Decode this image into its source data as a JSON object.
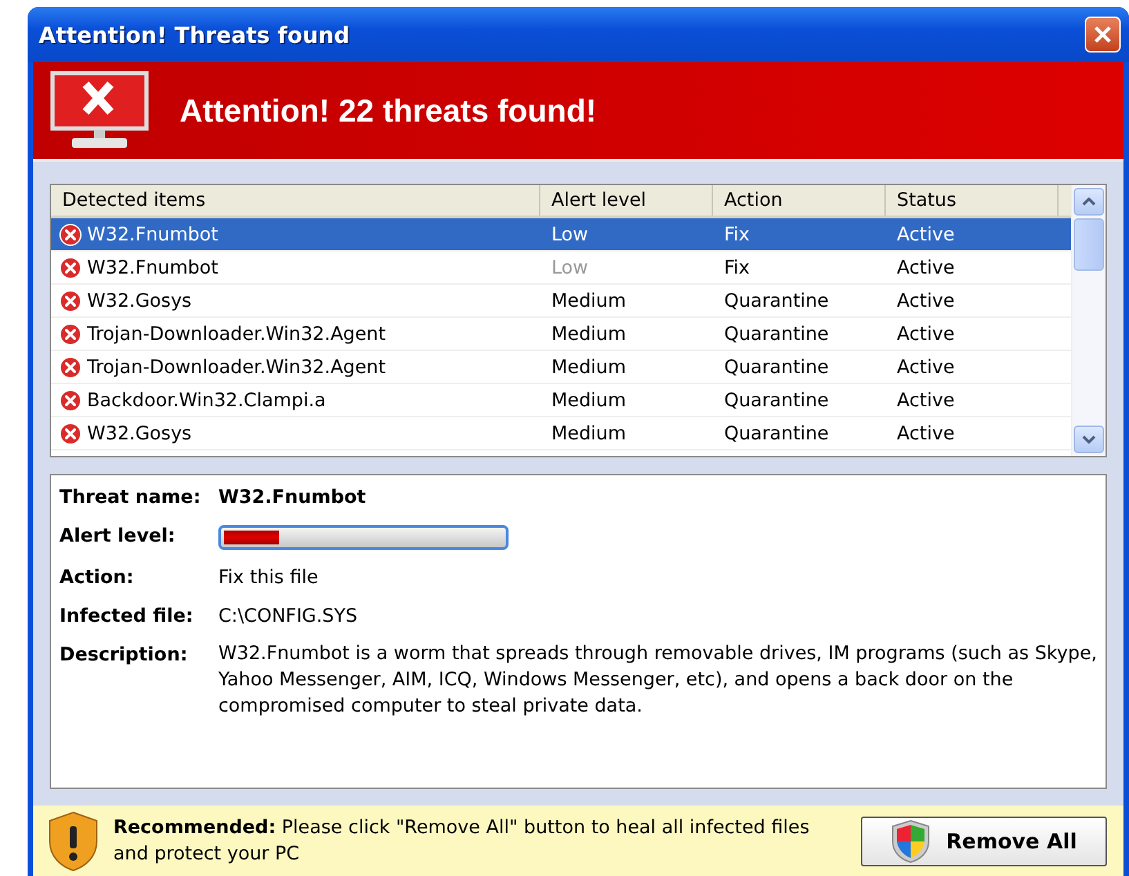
{
  "window": {
    "title": "Attention! Threats found"
  },
  "banner": {
    "text": "Attention! 22 threats found!"
  },
  "table": {
    "columns": [
      "Detected items",
      "Alert level",
      "Action",
      "Status"
    ],
    "rows": [
      {
        "name": "W32.Fnumbot",
        "alert": "Low",
        "alert_dimmed": false,
        "action": "Fix",
        "status": "Active",
        "selected": true
      },
      {
        "name": "W32.Fnumbot",
        "alert": "Low",
        "alert_dimmed": true,
        "action": "Fix",
        "status": "Active",
        "selected": false
      },
      {
        "name": "W32.Gosys",
        "alert": "Medium",
        "alert_dimmed": false,
        "action": "Quarantine",
        "status": "Active",
        "selected": false
      },
      {
        "name": "Trojan-Downloader.Win32.Agent",
        "alert": "Medium",
        "alert_dimmed": false,
        "action": "Quarantine",
        "status": "Active",
        "selected": false
      },
      {
        "name": "Trojan-Downloader.Win32.Agent",
        "alert": "Medium",
        "alert_dimmed": false,
        "action": "Quarantine",
        "status": "Active",
        "selected": false
      },
      {
        "name": "Backdoor.Win32.Clampi.a",
        "alert": "Medium",
        "alert_dimmed": false,
        "action": "Quarantine",
        "status": "Active",
        "selected": false
      },
      {
        "name": "W32.Gosys",
        "alert": "Medium",
        "alert_dimmed": false,
        "action": "Quarantine",
        "status": "Active",
        "selected": false
      }
    ]
  },
  "details": {
    "threat_name_label": "Threat name:",
    "threat_name": "W32.Fnumbot",
    "alert_label": "Alert level:",
    "alert_level": {
      "level": 0.2
    },
    "action_label": "Action:",
    "action": "Fix this file",
    "file_label": "Infected file:",
    "file": "C:\\CONFIG.SYS",
    "description_label": "Description:",
    "description": "W32.Fnumbot is a worm that spreads through removable drives, IM programs (such as Skype, Yahoo Messenger, AIM, ICQ, Windows Messenger, etc), and opens a back door on the compromised computer to steal private data."
  },
  "footer": {
    "message": "**Recommended:** Please click \"Remove All\" button to heal all infected files and protect your PC",
    "button": "Remove All"
  }
}
